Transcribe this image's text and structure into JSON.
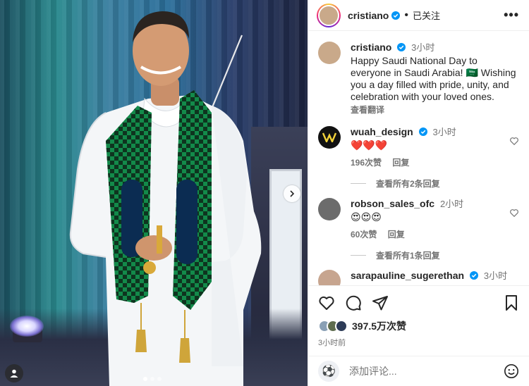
{
  "header": {
    "username": "cristiano",
    "separator": "•",
    "follow_status": "已关注",
    "more": "•••"
  },
  "caption": {
    "username": "cristiano",
    "time": "3小时",
    "text": "Happy Saudi National Day to everyone in Saudi Arabia! 🇸🇦 Wishing you a day filled with pride, unity, and celebration with your loved ones.",
    "translate": "查看翻译"
  },
  "comments": [
    {
      "username": "wuah_design",
      "time": "3小时",
      "text": "❤️❤️❤️",
      "likes": "196次赞",
      "reply": "回复",
      "view_replies": "查看所有2条回复"
    },
    {
      "username": "robson_sales_ofc",
      "time": "2小时",
      "text": "😍😍😍",
      "likes": "60次赞",
      "reply": "回复",
      "view_replies": "查看所有1条回复"
    },
    {
      "username": "sarapauline_sugerethan",
      "time": "3小时"
    }
  ],
  "actions": {
    "like_count": "397.5万次赞",
    "posted_ago": "3小时前"
  },
  "add_comment": {
    "placeholder": "添加评论..."
  },
  "colors": {
    "verified": "#0095f6",
    "muted": "#737373",
    "text": "#262626"
  }
}
